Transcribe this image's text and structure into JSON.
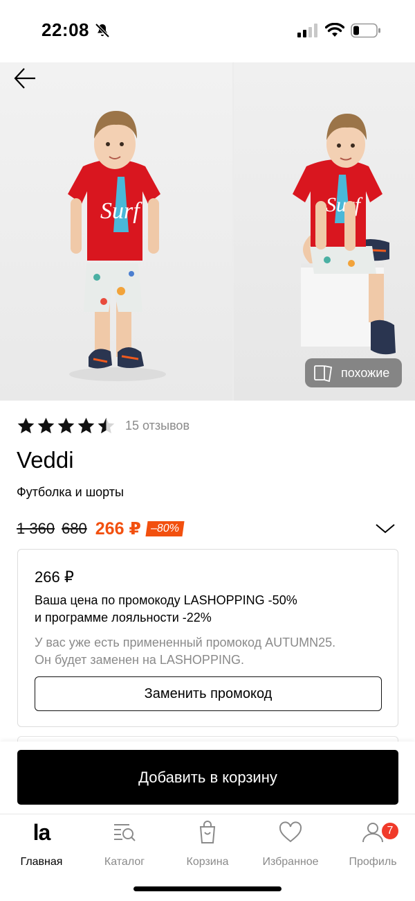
{
  "status_bar": {
    "time": "22:08"
  },
  "gallery": {
    "similar_label": "похожие",
    "active_index": 1,
    "photo_count": 2
  },
  "product": {
    "rating": 4.5,
    "reviews_label": "15 отзывов",
    "brand": "Veddi",
    "name": "Футболка и шорты",
    "price_original": "1 360",
    "price_old": "680",
    "price_current": "266 ₽",
    "discount_label": "–80%"
  },
  "promo": {
    "price": "266 ₽",
    "desc_line1": "Ваша цена по промокоду LASHOPPING -50%",
    "desc_line2": "и программе лояльности -22%",
    "note_line1": "У вас уже есть примененный промокод AUTUMN25.",
    "note_line2": "Он будет заменен на LASHOPPING.",
    "replace_label": "Заменить промокод"
  },
  "cart": {
    "add_label": "Добавить в корзину"
  },
  "nav": {
    "home_logo": "la",
    "home": "Главная",
    "catalog": "Каталог",
    "cart": "Корзина",
    "favorites": "Избранное",
    "profile": "Профиль",
    "profile_badge": "7"
  },
  "colors": {
    "accent": "#f2500f",
    "badge": "#f03a2a",
    "primary_button": "#000000"
  }
}
